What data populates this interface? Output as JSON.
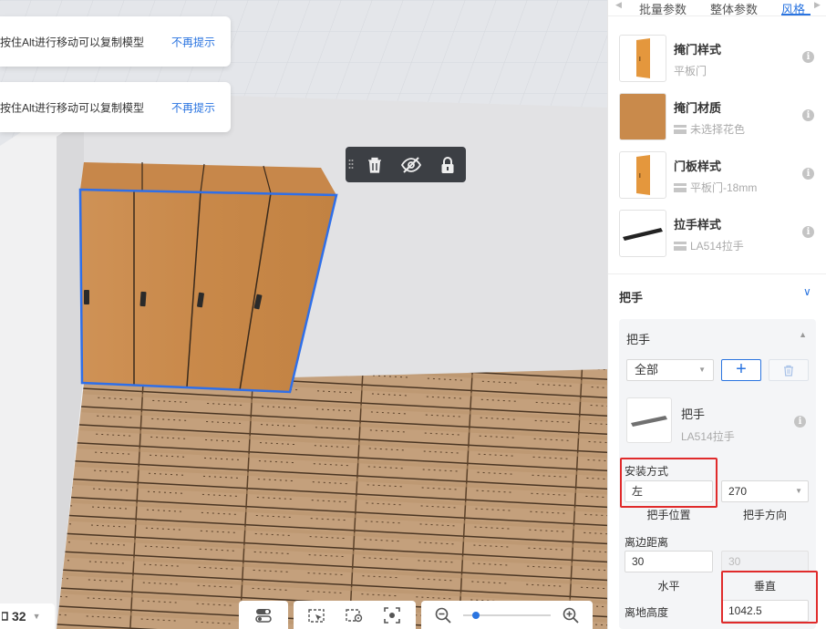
{
  "toasts": [
    {
      "message": "按住Alt进行移动可以复制模型",
      "action": "不再提示"
    },
    {
      "message": "按住Alt进行移动可以复制模型",
      "action": "不再提示"
    }
  ],
  "object_toolbar": {
    "icons": [
      "drag-grip-icon",
      "trash-icon",
      "eye-off-icon",
      "lock-icon"
    ]
  },
  "bottom_bar": {
    "layer_count": "32",
    "zoom_percent": 15
  },
  "panel": {
    "tabs": [
      "批量参数",
      "整体参数",
      "风格"
    ],
    "active_tab": "风格",
    "style_items": [
      {
        "title": "掩门样式",
        "sub": "平板门",
        "has_sub_icon": false
      },
      {
        "title": "掩门材质",
        "sub": "未选择花色",
        "has_sub_icon": true
      },
      {
        "title": "门板样式",
        "sub": "平板门-18mm",
        "has_sub_icon": true
      },
      {
        "title": "拉手样式",
        "sub": "LA514拉手",
        "has_sub_icon": true
      }
    ],
    "handle_section": {
      "header": "把手",
      "card_title": "把手",
      "select_value": "全部",
      "add_label": "+",
      "item": {
        "title": "把手",
        "sub": "LA514拉手"
      },
      "install_label": "安装方式",
      "position_value": "左",
      "position_caption": "把手位置",
      "direction_value": "270",
      "direction_caption": "把手方向",
      "edge_label": "离边距离",
      "horizontal_value": "30",
      "vertical_value": "30",
      "horizontal_caption": "水平",
      "vertical_caption": "垂直",
      "ground_label": "离地高度",
      "ground_value": "1042.5"
    }
  },
  "colors": {
    "accent": "#2a74e0",
    "highlight": "#e02b2b",
    "wood": "#c98a4b",
    "selection": "#2f6fe8"
  }
}
